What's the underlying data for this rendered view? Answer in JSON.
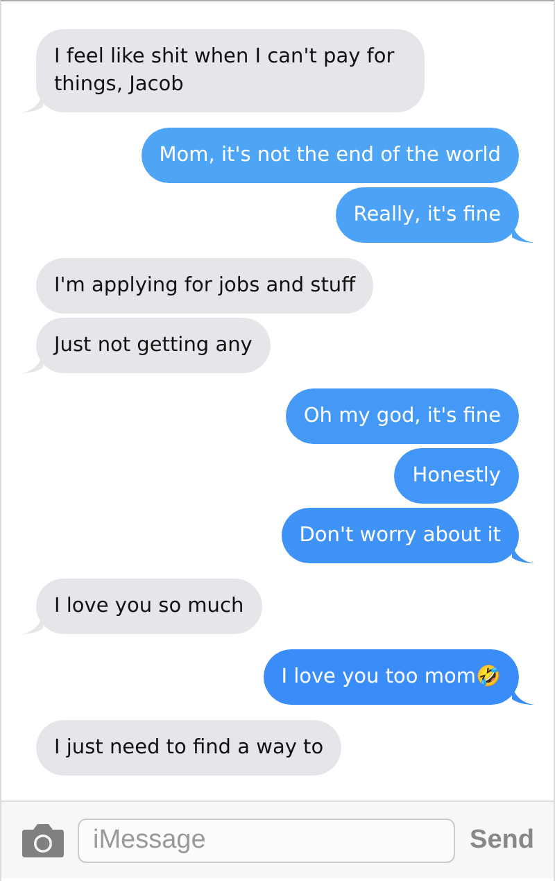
{
  "messages": [
    {
      "kind": "received",
      "text": "I feel like shit when I can't pay for things, Jacob",
      "tail": true
    },
    {
      "kind": "sent",
      "text": "Mom, it's not the end of the world",
      "tail": false
    },
    {
      "kind": "sent",
      "text": "Really, it's fine",
      "tail": true
    },
    {
      "kind": "received",
      "text": "I'm applying for jobs and stuff",
      "tail": false
    },
    {
      "kind": "received",
      "text": "Just not getting any",
      "tail": true
    },
    {
      "kind": "sent",
      "text": "Oh my god, it's fine",
      "tail": false
    },
    {
      "kind": "sent",
      "text": "Honestly",
      "tail": false
    },
    {
      "kind": "sent",
      "text": "Don't worry about it",
      "tail": true
    },
    {
      "kind": "received",
      "text": "I love you so much",
      "tail": true
    },
    {
      "kind": "sent",
      "text": "I love you too mom🤣",
      "tail": true
    },
    {
      "kind": "received",
      "text": "I just need to find a way to",
      "tail": false
    }
  ],
  "composer": {
    "placeholder": "iMessage",
    "send": "Send"
  }
}
